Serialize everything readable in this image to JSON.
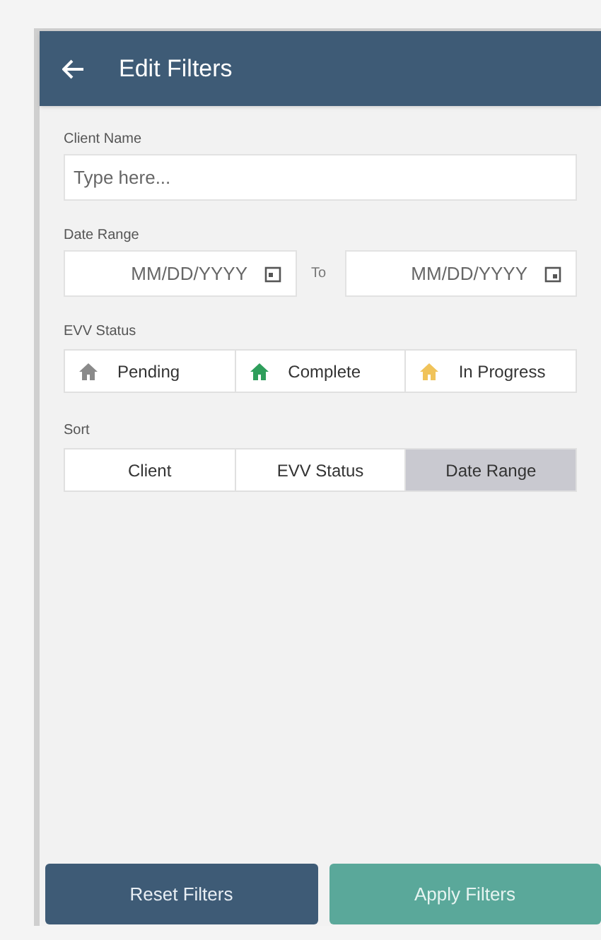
{
  "header": {
    "title": "Edit Filters"
  },
  "client_name": {
    "label": "Client Name",
    "placeholder": "Type here..."
  },
  "date_range": {
    "label": "Date Range",
    "from_placeholder": "MM/DD/YYYY",
    "separator": "To",
    "to_placeholder": "MM/DD/YYYY"
  },
  "evv_status": {
    "label": "EVV Status",
    "options": [
      {
        "label": "Pending",
        "color": "#8a8a8a"
      },
      {
        "label": "Complete",
        "color": "#2e9e5b"
      },
      {
        "label": "In Progress",
        "color": "#f0c35a"
      }
    ]
  },
  "sort": {
    "label": "Sort",
    "options": [
      {
        "label": "Client",
        "selected": false
      },
      {
        "label": "EVV Status",
        "selected": false
      },
      {
        "label": "Date Range",
        "selected": true
      }
    ]
  },
  "buttons": [
    {
      "label": "Reset Filters",
      "kind": "secondary"
    },
    {
      "label": "Apply Filters",
      "kind": "primary"
    }
  ]
}
